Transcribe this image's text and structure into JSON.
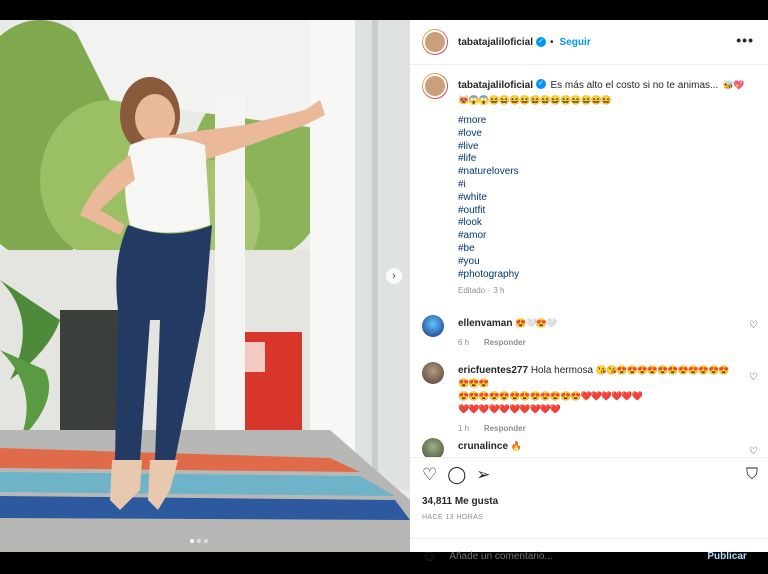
{
  "header": {
    "username": "tabatajaliloficial",
    "follow_label": "Seguir",
    "more_label": "•••"
  },
  "caption": {
    "username": "tabatajaliloficial",
    "text": "Es más alto el costo si no te animas...",
    "emoji_line_1": "🐝💖",
    "emoji_line_2": "😻😱😱😆😆😆😆😆😆😆😆😆😆😆😆",
    "hashtags": [
      "#more",
      "#love",
      "#live",
      "#life",
      "#naturelovers",
      "#i",
      "#white",
      "#outfit",
      "#look",
      "#amor",
      "#be",
      "#you",
      "#photography"
    ],
    "edited_label": "Editado",
    "time": "3 h"
  },
  "comments": [
    {
      "username": "ellenvaman",
      "text": "😍🤍😍🤍",
      "time": "6 h",
      "reply_label": "Responder"
    },
    {
      "username": "ericfuentes277",
      "text": "Hola hermosa",
      "emojis_1": "😘😘😍😍😍😍😍😍😍😍😍😍😍😍😍😍",
      "emojis_2": "😍😍😍😍😍😍😍😍😍😍😍😍❤️❤️❤️❤️❤️❤️",
      "emojis_3": "❤️❤️❤️❤️❤️❤️❤️❤️❤️❤️",
      "time": "1 h",
      "reply_label": "Responder"
    },
    {
      "username": "crunalince",
      "text": "🔥"
    }
  ],
  "actions": {
    "like_icon": "♡",
    "comment_icon": "◯",
    "share_icon": "➢",
    "save_icon": "⛉"
  },
  "likes": "34,811 Me gusta",
  "posted_ago": "HACE 13 HORAS",
  "comment_box": {
    "emoji_icon": "☺",
    "placeholder": "Añade un comentario...",
    "post_label": "Publicar"
  },
  "carousel": {
    "next_icon": "›"
  }
}
